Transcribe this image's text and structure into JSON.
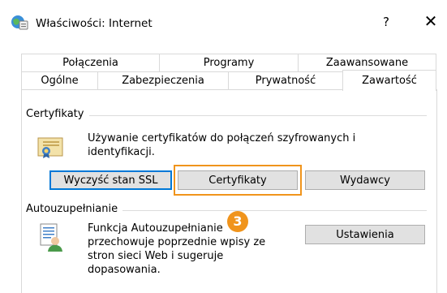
{
  "window": {
    "title": "Właściwości: Internet",
    "help_glyph": "?",
    "close_glyph": "✕"
  },
  "tabs_back": [
    "Połączenia",
    "Programy",
    "Zaawansowane"
  ],
  "tabs_front": [
    "Ogólne",
    "Zabezpieczenia",
    "Prywatność",
    "Zawartość"
  ],
  "selected_tab": "Zawartość",
  "certificates": {
    "group_label": "Certyfikaty",
    "description_line1": "Używanie certyfikatów do połączeń szyfrowanych i",
    "description_line2": "identyfikacji.",
    "clear_ssl_label": "Wyczyść stan SSL",
    "certificates_label": "Certyfikaty",
    "publishers_label": "Wydawcy"
  },
  "autocomplete": {
    "group_label": "Autouzupełnianie",
    "description_line1": "Funkcja Autouzupełnianie",
    "description_line2": "przechowuje poprzednie wpisy ze",
    "description_line3": "stron sieci Web i sugeruje",
    "description_line4": "dopasowania.",
    "settings_label": "Ustawienia"
  },
  "annotation": {
    "step_number": "3"
  },
  "colors": {
    "accent_orange": "#f0941c",
    "focus_blue": "#0078d7"
  }
}
